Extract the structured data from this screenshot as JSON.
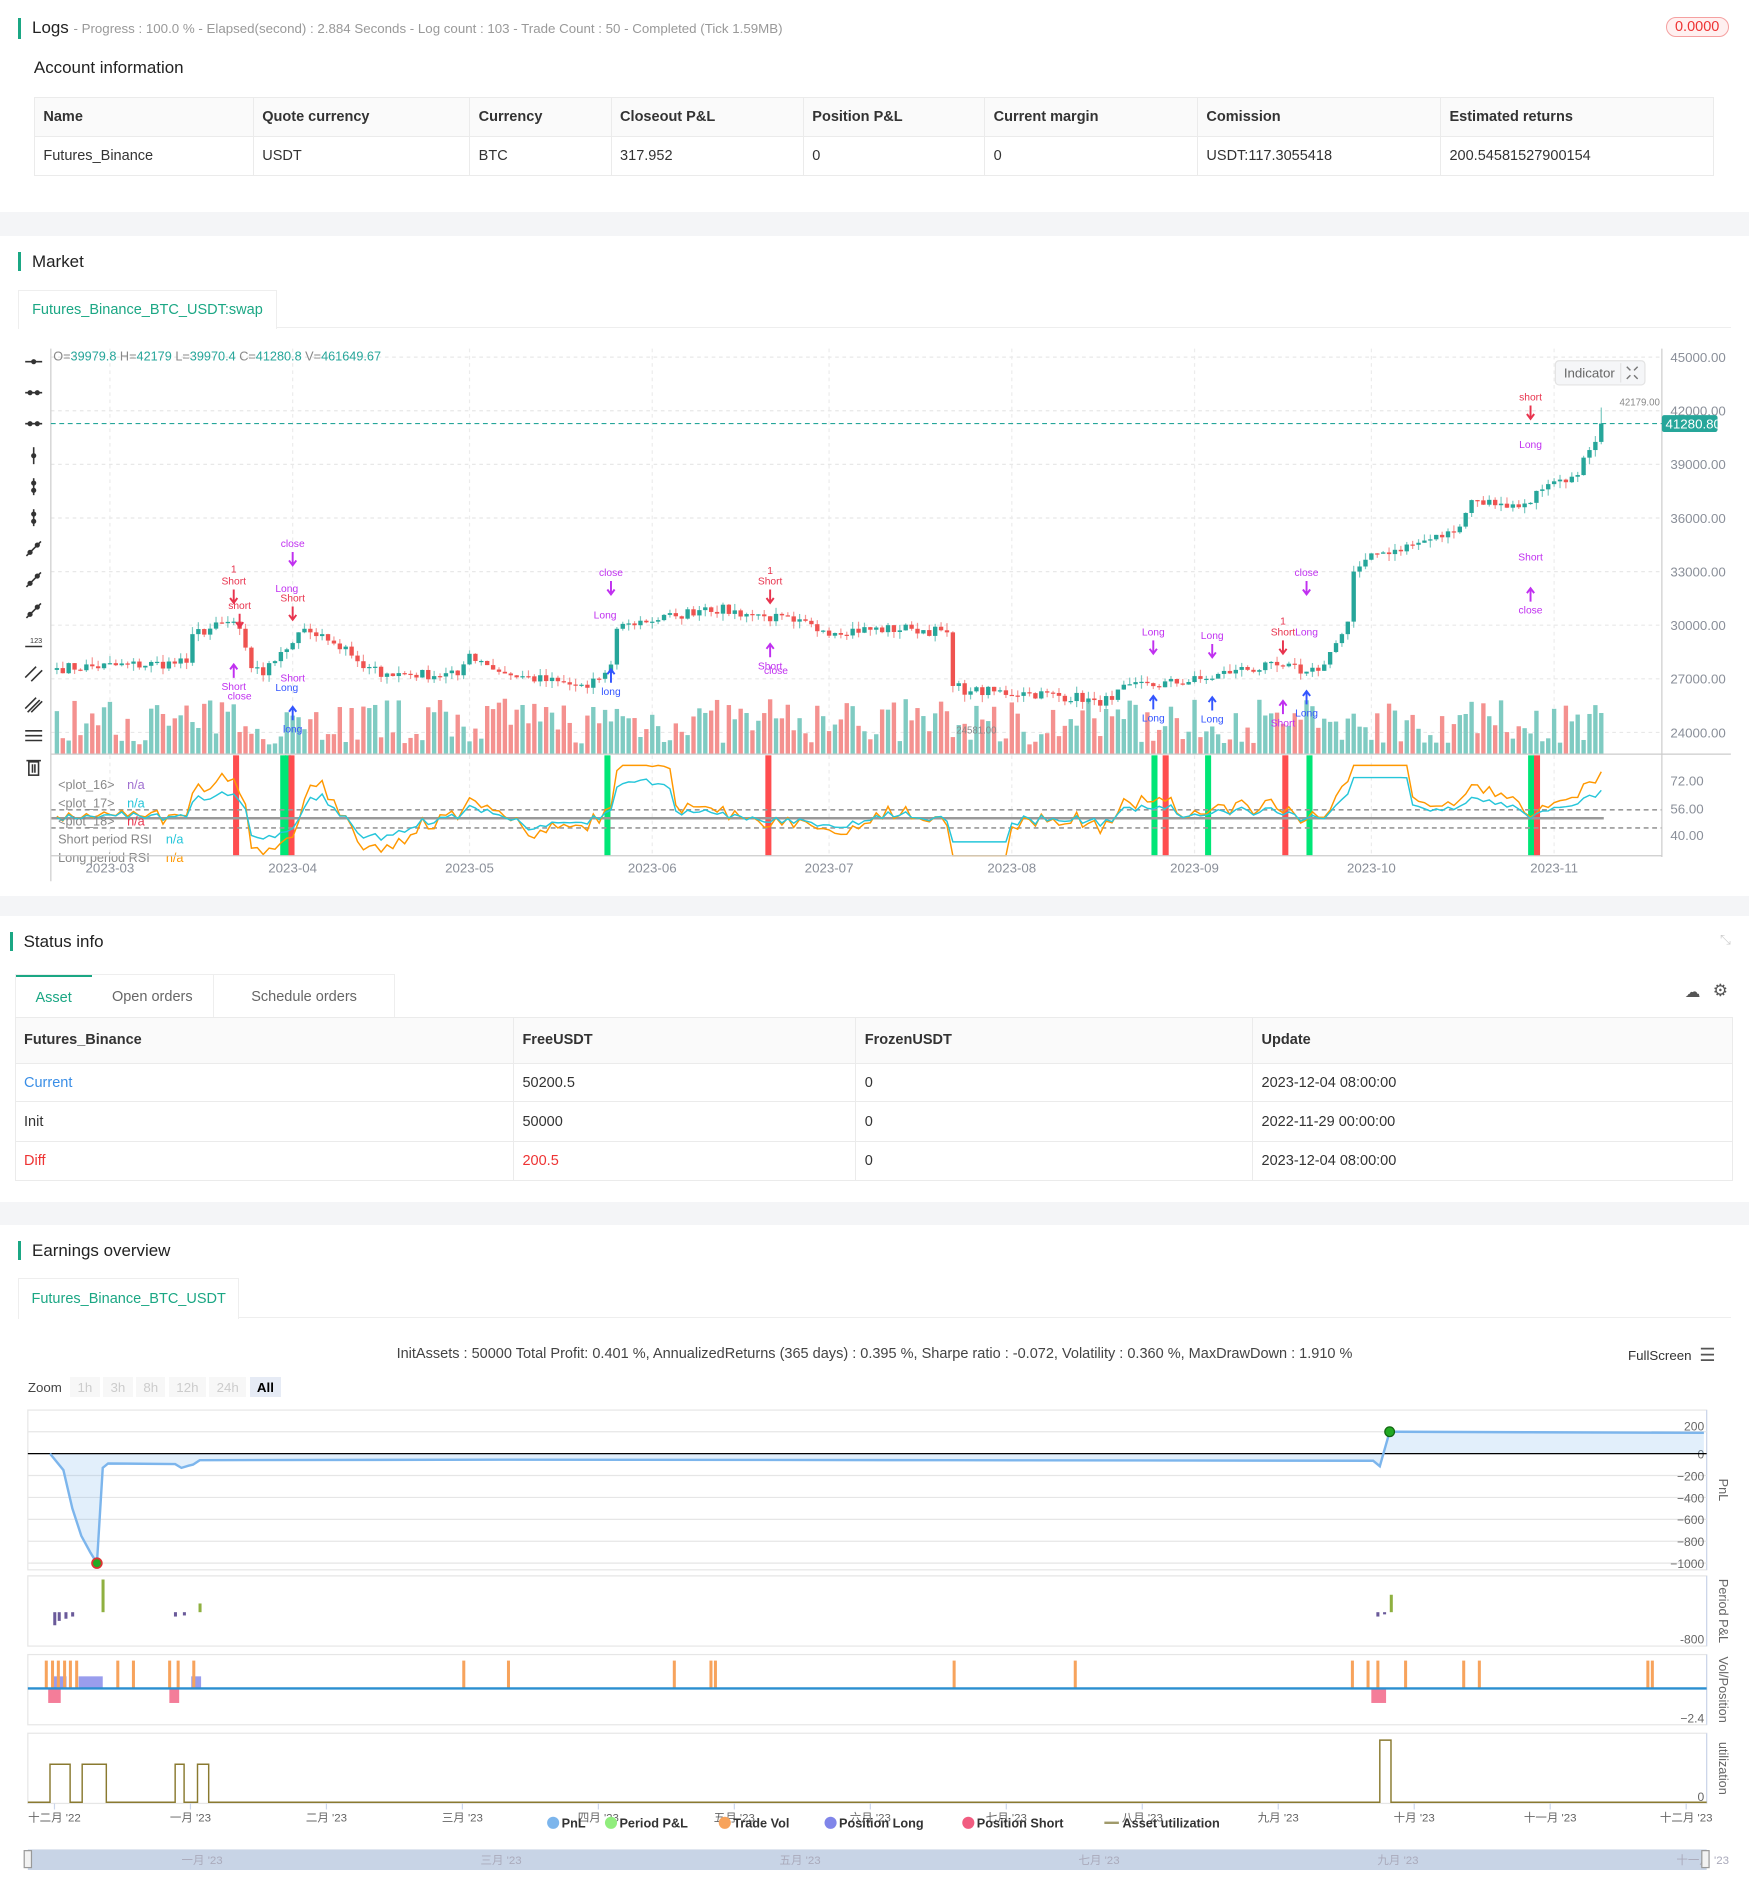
{
  "logs": {
    "title": "Logs",
    "progress": "- Progress : 100.0 % - Elapsed(second) : 2.884  Seconds - Log count : 103 - Trade Count : 50 - Completed (Tick 1.59MB)",
    "badge": "0.0000"
  },
  "account": {
    "title": "Account information",
    "headers": [
      "Name",
      "Quote currency",
      "Currency",
      "Closeout P&L",
      "Position P&L",
      "Current margin",
      "Comission",
      "Estimated returns"
    ],
    "row": [
      "Futures_Binance",
      "USDT",
      "BTC",
      "317.952",
      "0",
      "0",
      "USDT:117.3055418",
      "200.54581527900154"
    ]
  },
  "market": {
    "title": "Market",
    "tab": "Futures_Binance_BTC_USDT:swap",
    "indicator_button": "Indicator",
    "colors": {
      "up": "#26a69a",
      "down": "#ef5350",
      "signal_red": "#ff4d4f",
      "signal_green": "#00e676",
      "rsi_short": "#26c6da",
      "rsi_long": "#ff9800"
    },
    "toolbar_icons": [
      "horizontal-line-icon",
      "horizontal-ray-icon",
      "extended-line-icon",
      "vertical-line-icon",
      "vertical-segment-icon",
      "vertical-measure-icon",
      "trend-line-icon",
      "ray-icon",
      "segment-icon",
      "price-label-icon",
      "parallel-channel-icon",
      "pitchfork-icon",
      "fib-levels-icon",
      "trash-icon"
    ]
  },
  "chart_data": [
    {
      "type": "candlestick",
      "title": "Futures_Binance_BTC_USDT:swap",
      "ohlc_text": {
        "o_label": "O=",
        "o": "39979.8",
        "h_label": " H=",
        "h": "42179",
        "l_label": " L=",
        "l": "39970.4",
        "c_label": " C=",
        "c": "41280.8",
        "v_label": " V=",
        "v": "461649.67"
      },
      "y_ticks": [
        "45000.00",
        "42000.00",
        "39000.00",
        "36000.00",
        "33000.00",
        "30000.00",
        "27000.00",
        "24000.00"
      ],
      "ylim": [
        24000,
        45000
      ],
      "x_ticks": [
        {
          "label": "2023-03",
          "day": 9
        },
        {
          "label": "2023-04",
          "day": 40
        },
        {
          "label": "2023-05",
          "day": 70
        },
        {
          "label": "2023-06",
          "day": 101
        },
        {
          "label": "2023-07",
          "day": 131
        },
        {
          "label": "2023-08",
          "day": 162
        },
        {
          "label": "2023-09",
          "day": 193
        },
        {
          "label": "2023-10",
          "day": 223
        },
        {
          "label": "2023-11",
          "day": 254
        }
      ],
      "last_price": "41280.80",
      "last_price_value": 41280.8,
      "high_label": "42179.00",
      "low_label": "24581.00",
      "close_anchors": [
        [
          0,
          27600
        ],
        [
          22,
          27900
        ],
        [
          23,
          29500
        ],
        [
          30,
          30200
        ],
        [
          31,
          29800
        ],
        [
          33,
          27600
        ],
        [
          35,
          27200
        ],
        [
          38,
          28500
        ],
        [
          40,
          29000
        ],
        [
          42,
          29800
        ],
        [
          45,
          29500
        ],
        [
          50,
          28300
        ],
        [
          52,
          27600
        ],
        [
          56,
          27300
        ],
        [
          68,
          27200
        ],
        [
          70,
          28400
        ],
        [
          72,
          28000
        ],
        [
          76,
          27300
        ],
        [
          90,
          26500
        ],
        [
          92,
          27000
        ],
        [
          94,
          27800
        ],
        [
          95,
          29800
        ],
        [
          97,
          30100
        ],
        [
          105,
          30500
        ],
        [
          110,
          31000
        ],
        [
          118,
          30600
        ],
        [
          120,
          30500
        ],
        [
          125,
          30200
        ],
        [
          130,
          29700
        ],
        [
          145,
          29800
        ],
        [
          151,
          29600
        ],
        [
          152,
          26600
        ],
        [
          155,
          26300
        ],
        [
          165,
          26200
        ],
        [
          175,
          25900
        ],
        [
          177,
          25500
        ],
        [
          180,
          26400
        ],
        [
          195,
          27000
        ],
        [
          200,
          27500
        ],
        [
          208,
          27700
        ],
        [
          212,
          27400
        ],
        [
          215,
          27800
        ],
        [
          216,
          28500
        ],
        [
          218,
          29500
        ],
        [
          219,
          30200
        ],
        [
          220,
          33000
        ],
        [
          224,
          34000
        ],
        [
          230,
          34500
        ],
        [
          237,
          35200
        ],
        [
          240,
          37000
        ],
        [
          245,
          36800
        ],
        [
          248,
          36600
        ],
        [
          252,
          37600
        ],
        [
          256,
          38000
        ],
        [
          258,
          38400
        ],
        [
          260,
          39800
        ],
        [
          262,
          41280
        ]
      ],
      "annotations": [
        {
          "day": 30,
          "price": 32946,
          "text": "1",
          "color": "#e8344e"
        },
        {
          "day": 30,
          "price": 32268,
          "text": "Short",
          "color": "#e8344e",
          "arrow": "down"
        },
        {
          "day": 31,
          "price": 30914,
          "text": "short",
          "color": "#e8344e",
          "arrow": "down"
        },
        {
          "day": 30,
          "price": 26377,
          "text": "Short",
          "color": "#c030f0",
          "arrow": "up"
        },
        {
          "day": 31,
          "price": 25835,
          "text": "close",
          "color": "#c030f0"
        },
        {
          "day": 40,
          "price": 34368,
          "text": "close",
          "color": "#c030f0",
          "arrow": "down"
        },
        {
          "day": 39,
          "price": 31862,
          "text": "Long",
          "color": "#c030f0"
        },
        {
          "day": 40,
          "price": 31320,
          "text": "Short",
          "color": "#e8344e",
          "arrow": "down"
        },
        {
          "day": 40,
          "price": 26851,
          "text": "Short",
          "color": "#c030f0"
        },
        {
          "day": 39,
          "price": 26310,
          "text": "Long",
          "color": "#3355ff"
        },
        {
          "day": 40,
          "price": 24007,
          "text": "long",
          "color": "#3355ff",
          "arrow": "up"
        },
        {
          "day": 94,
          "price": 32743,
          "text": "close",
          "color": "#c030f0",
          "arrow": "down"
        },
        {
          "day": 93,
          "price": 30372,
          "text": "Long",
          "color": "#c030f0"
        },
        {
          "day": 94,
          "price": 26106,
          "text": "long",
          "color": "#3355ff",
          "arrow": "up"
        },
        {
          "day": 121,
          "price": 32878,
          "text": "1",
          "color": "#e8344e"
        },
        {
          "day": 121,
          "price": 32268,
          "text": "Short",
          "color": "#e8344e",
          "arrow": "down"
        },
        {
          "day": 121,
          "price": 27528,
          "text": "Short",
          "color": "#c030f0",
          "arrow": "up"
        },
        {
          "day": 122,
          "price": 27257,
          "text": "close",
          "color": "#c030f0"
        },
        {
          "day": 186,
          "price": 29424,
          "text": "Long",
          "color": "#c030f0",
          "arrow": "down"
        },
        {
          "day": 186,
          "price": 24616,
          "text": "Long",
          "color": "#3355ff",
          "arrow": "up"
        },
        {
          "day": 196,
          "price": 29220,
          "text": "Long",
          "color": "#c030f0",
          "arrow": "down"
        },
        {
          "day": 196,
          "price": 24550,
          "text": "Long",
          "color": "#3355ff",
          "arrow": "up"
        },
        {
          "day": 208,
          "price": 30034,
          "text": "1",
          "color": "#e8344e"
        },
        {
          "day": 208,
          "price": 29424,
          "text": "Short",
          "color": "#e8344e",
          "arrow": "down"
        },
        {
          "day": 208,
          "price": 24345,
          "text": "Short",
          "color": "#c030f0",
          "arrow": "up"
        },
        {
          "day": 212,
          "price": 32743,
          "text": "close",
          "color": "#c030f0",
          "arrow": "down"
        },
        {
          "day": 212,
          "price": 29424,
          "text": "Long",
          "color": "#c030f0"
        },
        {
          "day": 212,
          "price": 24890,
          "text": "Long",
          "color": "#3355ff",
          "arrow": "up"
        },
        {
          "day": 250,
          "price": 42562,
          "text": "short",
          "color": "#e8344e",
          "arrow": "down"
        },
        {
          "day": 250,
          "price": 39921,
          "text": "Long",
          "color": "#c030f0"
        },
        {
          "day": 250,
          "price": 33623,
          "text": "Short",
          "color": "#c030f0"
        },
        {
          "day": 250,
          "price": 30643,
          "text": "close",
          "color": "#c030f0",
          "arrow": "up"
        }
      ],
      "signals": [
        {
          "day": 30.4,
          "color": "red"
        },
        {
          "day": 38.4,
          "color": "green"
        },
        {
          "day": 39.2,
          "color": "green"
        },
        {
          "day": 39.8,
          "color": "red"
        },
        {
          "day": 93.4,
          "color": "green"
        },
        {
          "day": 120.7,
          "color": "red"
        },
        {
          "day": 186.2,
          "color": "green"
        },
        {
          "day": 188.1,
          "color": "red"
        },
        {
          "day": 195.3,
          "color": "green"
        },
        {
          "day": 208.4,
          "color": "red"
        },
        {
          "day": 212.5,
          "color": "green"
        },
        {
          "day": 250.1,
          "color": "green"
        },
        {
          "day": 251.1,
          "color": "red"
        }
      ],
      "rsi": {
        "y_ticks": [
          "72.00",
          "56.00",
          "40.00"
        ],
        "ylim": [
          30,
          85
        ],
        "levels": [
          50,
          55,
          45
        ],
        "legend": [
          {
            "name": "<plot_16>",
            "value": "n/a",
            "color": "#a070d0"
          },
          {
            "name": "<plot_17>",
            "value": "n/a",
            "color": "#26c6da"
          },
          {
            "name": "<plot_18>",
            "value": "n/a",
            "color": "#e8344e"
          },
          {
            "name": "Short period RSI",
            "value": "n/a",
            "color": "#26c6da"
          },
          {
            "name": "Long period RSI",
            "value": "n/a",
            "color": "#ff9800"
          }
        ]
      }
    },
    {
      "type": "line",
      "title": "InitAssets : 50000 Total Profit: 0.401 %, AnnualizedReturns (365 days) : 0.395 %, Sharpe ratio : -0.072, Volatility : 0.360 %, MaxDrawDown : 1.910 %",
      "x_ticks": [
        "十二月 '22",
        "一月 '23",
        "二月 '23",
        "三月 '23",
        "四月 '23",
        "五月 '23",
        "六月 '23",
        "七月 '23",
        "八月 '23",
        "九月 '23",
        "十月 '23",
        "十一月 '23",
        "十二月 '23"
      ],
      "navigator_ticks": [
        "一月 '23",
        "三月 '23",
        "五月 '23",
        "七月 '23",
        "九月 '23",
        "十一月 '23"
      ],
      "pnl": {
        "axis_label": "PnL",
        "y_ticks": [
          200,
          0,
          -200,
          -400,
          -600,
          -800,
          -1000
        ],
        "points": [
          [
            -1,
            0
          ],
          [
            2,
            -150
          ],
          [
            4,
            -500
          ],
          [
            6,
            -750
          ],
          [
            8,
            -900
          ],
          [
            9.5,
            -1000
          ],
          [
            10.8,
            -130
          ],
          [
            12,
            -90
          ],
          [
            27,
            -95
          ],
          [
            28.4,
            -130
          ],
          [
            30,
            -110
          ],
          [
            31,
            -100
          ],
          [
            32.5,
            -60
          ],
          [
            100,
            -55
          ],
          [
            200,
            -60
          ],
          [
            295,
            -65
          ],
          [
            296.5,
            -115
          ],
          [
            298.7,
            200
          ],
          [
            330,
            195
          ],
          [
            369,
            190
          ]
        ]
      },
      "period_pnl": {
        "axis_label": "Period P&L",
        "y_tick": "-800",
        "bars": [
          [
            0,
            -60
          ],
          [
            1,
            -40
          ],
          [
            2.5,
            -30
          ],
          [
            4,
            -20
          ],
          [
            10.8,
            150
          ],
          [
            27,
            -20
          ],
          [
            29,
            -15
          ],
          [
            32.5,
            40
          ],
          [
            296,
            -20
          ],
          [
            297.5,
            -10
          ],
          [
            299,
            80
          ]
        ]
      },
      "vol_position": {
        "axis_label": "Vol/Position",
        "y_tick": "-2.4",
        "trades": [
          -1.9,
          -0.5,
          0.8,
          2.2,
          3.5,
          4.9,
          14.1,
          17.6,
          25.7,
          27.6,
          31.1,
          91.5,
          101.5,
          138.6,
          146.8,
          147.8,
          201.2,
          228.3,
          290.3,
          293.8,
          296,
          302.2,
          315.2,
          318.7,
          356.4,
          357.4
        ],
        "long": [
          [
            -0.5,
            2.7
          ],
          [
            5.4,
            10.8
          ],
          [
            30.6,
            32.8
          ]
        ],
        "short": [
          [
            -1.4,
            1.4
          ],
          [
            25.7,
            27.9
          ],
          [
            294.6,
            297.9
          ]
        ]
      },
      "utilization": {
        "axis_label": "utilization",
        "y_tick": "0",
        "spans": [
          [
            -1,
            3.5,
            0.55
          ],
          [
            6.2,
            11.6,
            0.55
          ],
          [
            27,
            29,
            0.55
          ],
          [
            32,
            34.5,
            0.55
          ],
          [
            296.5,
            299,
            0.9
          ]
        ]
      },
      "legend": [
        {
          "name": "PnL",
          "color": "#7cb5ec"
        },
        {
          "name": "Period P&L",
          "color": "#90ed7d"
        },
        {
          "name": "Trade Vol",
          "color": "#f7a35c"
        },
        {
          "name": "Position Long",
          "color": "#8085e9"
        },
        {
          "name": "Position Short",
          "color": "#f15c80"
        },
        {
          "name": "Asset utilization",
          "color": "#a09a6b"
        }
      ]
    }
  ],
  "status": {
    "title": "Status info",
    "tabs": [
      "Asset",
      "Open orders",
      "Schedule orders"
    ],
    "headers": [
      "Futures_Binance",
      "FreeUSDT",
      "FrozenUSDT",
      "Update"
    ],
    "rows": [
      [
        "Current",
        "50200.5",
        "0",
        "2023-12-04 08:00:00"
      ],
      [
        "Init",
        "50000",
        "0",
        "2022-11-29 00:00:00"
      ],
      [
        "Diff",
        "200.5",
        "0",
        "2023-12-04 08:00:00"
      ]
    ]
  },
  "earnings": {
    "title": "Earnings overview",
    "tab": "Futures_Binance_BTC_USDT",
    "fullscreen": "FullScreen",
    "zoom_label": "Zoom",
    "zoom_buttons": [
      "1h",
      "3h",
      "8h",
      "12h",
      "24h",
      "All"
    ]
  }
}
